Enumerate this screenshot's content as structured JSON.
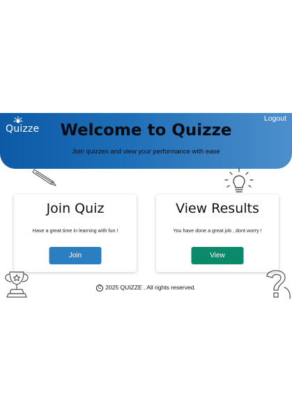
{
  "header": {
    "logo_text": "Quizze",
    "logout_label": "Logout",
    "title": "Welcome to Quizze",
    "subtitle": "Join quizzes  and view your performance with ease"
  },
  "cards": {
    "join": {
      "title": "Join Quiz",
      "text": "Have a great time in learning with fun !",
      "button_label": "Join"
    },
    "results": {
      "title": "View Results",
      "text": "You have done a great job ,  dont worry !",
      "button_label": "View"
    }
  },
  "footer": {
    "copyright_symbol": "C",
    "text": "2025 QUIZZE . All rights reserved."
  },
  "colors": {
    "header_gradient_start": "#0d5aa7",
    "header_gradient_end": "#4d8fcb",
    "join_button": "#2b7fc1",
    "view_button": "#0a8a6a"
  },
  "icons": [
    "logo-rays-icon",
    "pencil-icon",
    "lightbulb-icon",
    "trophy-icon",
    "question-mark-icon"
  ]
}
